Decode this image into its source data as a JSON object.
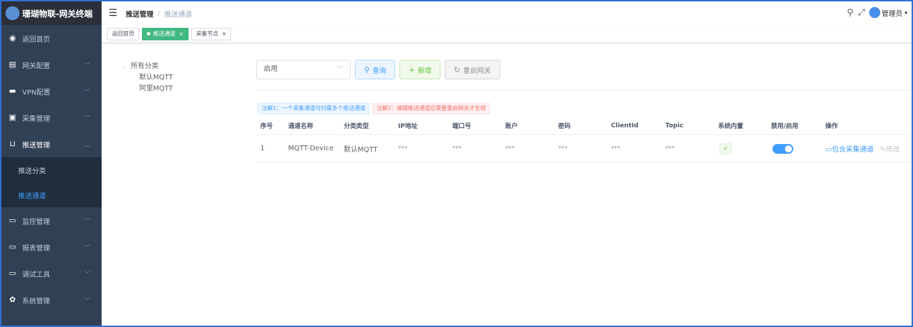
{
  "app": {
    "title": "珊瑚物联-网关终端"
  },
  "sidebar": {
    "items": [
      {
        "label": "返回首页",
        "icon": "dashboard-icon"
      },
      {
        "label": "网关配置",
        "icon": "document-icon"
      },
      {
        "label": "VPN配置",
        "icon": "monitor-icon"
      },
      {
        "label": "采集管理",
        "icon": "clipboard-icon"
      },
      {
        "label": "推送管理",
        "icon": "tray-icon"
      },
      {
        "label": "监控管理",
        "icon": "monitor-icon"
      },
      {
        "label": "报表管理",
        "icon": "monitor-icon"
      },
      {
        "label": "调试工具",
        "icon": "monitor-icon"
      },
      {
        "label": "系统管理",
        "icon": "gear-icon"
      }
    ],
    "submenu": [
      {
        "label": "推送分类"
      },
      {
        "label": "推送通道"
      }
    ]
  },
  "header": {
    "breadcrumb": [
      "推送管理",
      "推送通道"
    ],
    "user": "管理员"
  },
  "tags": [
    {
      "label": "返回首页"
    },
    {
      "label": "推送通道"
    },
    {
      "label": "采集节点"
    }
  ],
  "tree": {
    "root": "所有分类",
    "children": [
      "默认MQTT",
      "阿里MQTT"
    ]
  },
  "toolbar": {
    "select_value": "启用",
    "query": "查询",
    "add": "新增",
    "restart": "重启网关"
  },
  "notes": [
    "注解1：一个采集通道可归属多个推送通道",
    "注解2：编辑推送通道后需要重启网关才生效"
  ],
  "table": {
    "headers": [
      "序号",
      "通道名称",
      "分类类型",
      "IP地址",
      "端口号",
      "账户",
      "密码",
      "ClientId",
      "Topic",
      "系统内置",
      "禁用/启用",
      "操作"
    ],
    "rows": [
      {
        "index": "1",
        "name": "MQTT-Device",
        "category": "默认MQTT",
        "ip": "***",
        "port": "***",
        "account": "***",
        "password": "***",
        "client_id": "***",
        "topic": "***",
        "system_builtin": "✓",
        "enabled": true,
        "op_include": "包含采集通道",
        "op_edit": "修改"
      }
    ]
  },
  "colors": {
    "sidebar_bg": "#304156",
    "accent": "#409eff",
    "tag_active": "#42b983"
  }
}
